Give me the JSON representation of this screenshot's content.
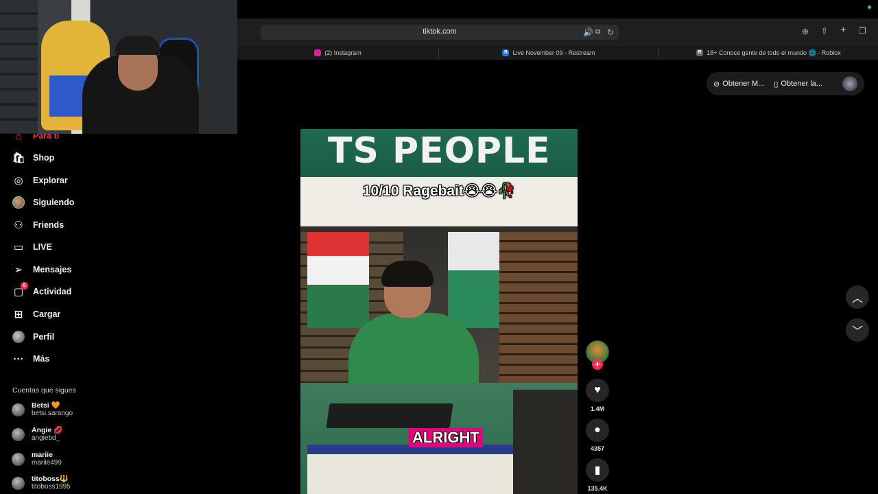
{
  "browser": {
    "url": "tiktok.com",
    "tabs": [
      {
        "label": "(2) Instagram",
        "fav_color": "#d6249f"
      },
      {
        "label": "Live November 09 - Restream",
        "fav_color": "#2a6fe0",
        "fav_letter": "R"
      },
      {
        "label": "18+ Conoce gente de todo el mundo 🌐 - Roblox",
        "fav_color": "#666666",
        "fav_letter": "R"
      }
    ]
  },
  "get_app": {
    "item1": "Obtener M...",
    "item2": "Obtener la..."
  },
  "sidebar": {
    "items": [
      {
        "label": "Para ti",
        "icon": "home-icon",
        "active": true
      },
      {
        "label": "Shop",
        "icon": "shop-icon"
      },
      {
        "label": "Explorar",
        "icon": "compass-icon"
      },
      {
        "label": "Siguiendo",
        "icon": "avatar-icon"
      },
      {
        "label": "Friends",
        "icon": "friends-icon"
      },
      {
        "label": "LIVE",
        "icon": "live-icon"
      },
      {
        "label": "Mensajes",
        "icon": "messages-icon"
      },
      {
        "label": "Actividad",
        "icon": "activity-icon",
        "badge": "6"
      },
      {
        "label": "Cargar",
        "icon": "upload-icon"
      },
      {
        "label": "Perfil",
        "icon": "profile-icon"
      },
      {
        "label": "Más",
        "icon": "more-icon"
      }
    ],
    "following_title": "Cuentas que sigues",
    "accounts": [
      {
        "name": "Betsi 🧡",
        "handle": "betsi.sarango"
      },
      {
        "name": "Angie 💋",
        "handle": "angiebd_"
      },
      {
        "name": "mariie",
        "handle": "mariie499"
      },
      {
        "name": "titoboss🔱",
        "handle": "titoboss1995"
      }
    ]
  },
  "video": {
    "sign": "TS PEOPLE",
    "caption_top": "10/10 Ragebait😭😭🥀",
    "caption_bottom": "ALRIGHT"
  },
  "actions": {
    "likes": "1.4M",
    "comments": "4357",
    "saves": "135.4K"
  },
  "colors": {
    "accent": "#fe2c55"
  }
}
